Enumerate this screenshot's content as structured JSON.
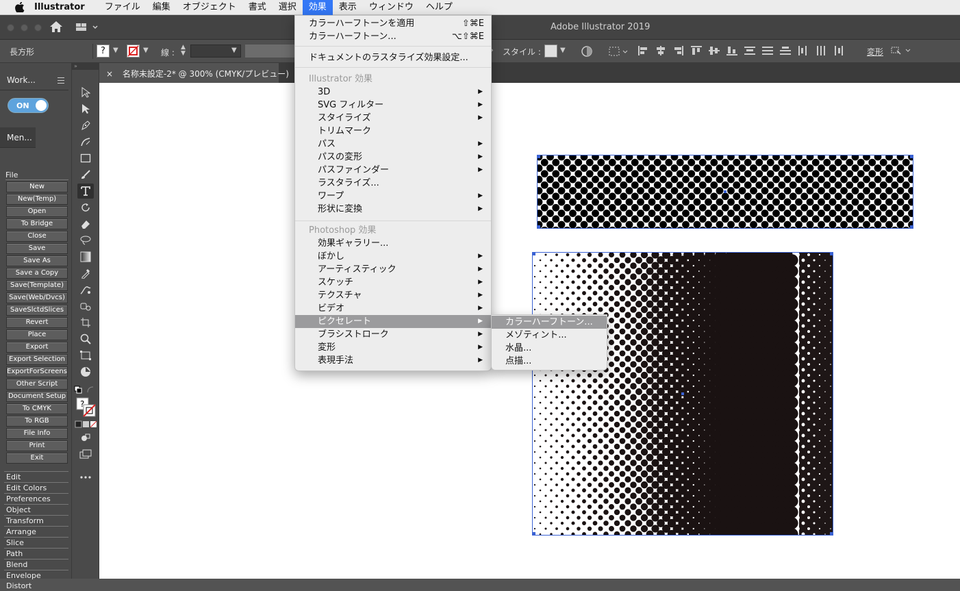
{
  "menubar": {
    "app_name": "Illustrator",
    "items": [
      "ファイル",
      "編集",
      "オブジェクト",
      "書式",
      "選択",
      "効果",
      "表示",
      "ウィンドウ",
      "ヘルプ"
    ],
    "active_index": 5
  },
  "window": {
    "title": "Adobe Illustrator 2019"
  },
  "control_bar": {
    "shape_label": "長方形",
    "fill_value": "?",
    "stroke_label": "線 :",
    "style_label": "スタイル :",
    "transform_label": "変形"
  },
  "document": {
    "tab_title": "名称未設定-2* @ 300% (CMYK/プレビュー)",
    "close_glyph": "×"
  },
  "left_panel": {
    "collapse_left": "«",
    "collapse_right": "»",
    "tab1": "Work...",
    "tab2": "Men...",
    "toggle_label": "ON",
    "file_header": "File",
    "buttons": [
      "New",
      "New(Temp)",
      "Open",
      "To Bridge",
      "Close",
      "Save",
      "Save As",
      "Save a Copy",
      "Save(Template)",
      "Save(Web/Dvcs)",
      "SaveSlctdSlices",
      "Revert",
      "Place",
      "Export",
      "Export Selection",
      "ExportForScreens",
      "Other Script",
      "Document Setup",
      "To CMYK",
      "To RGB",
      "File Info",
      "Print",
      "Exit"
    ],
    "categories": [
      "Edit",
      "Edit Colors",
      "Preferences",
      "Object",
      "Transform",
      "Arrange",
      "Slice",
      "Path",
      "Blend",
      "Envelope Distort"
    ]
  },
  "effect_menu": {
    "apply_last": {
      "label": "カラーハーフトーンを適用",
      "shortcut": "⇧⌘E"
    },
    "last_effect": {
      "label": "カラーハーフトーン...",
      "shortcut": "⌥⇧⌘E"
    },
    "raster_settings": "ドキュメントのラスタライズ効果設定...",
    "illustrator_header": "Illustrator 効果",
    "illustrator_items": [
      {
        "label": "3D",
        "submenu": true
      },
      {
        "label": "SVG フィルター",
        "submenu": true
      },
      {
        "label": "スタイライズ",
        "submenu": true
      },
      {
        "label": "トリムマーク",
        "submenu": false
      },
      {
        "label": "パス",
        "submenu": true
      },
      {
        "label": "パスの変形",
        "submenu": true
      },
      {
        "label": "パスファインダー",
        "submenu": true
      },
      {
        "label": "ラスタライズ...",
        "submenu": false
      },
      {
        "label": "ワープ",
        "submenu": true
      },
      {
        "label": "形状に変換",
        "submenu": true
      }
    ],
    "photoshop_header": "Photoshop 効果",
    "photoshop_items": [
      {
        "label": "効果ギャラリー...",
        "submenu": false
      },
      {
        "label": "ぼかし",
        "submenu": true
      },
      {
        "label": "アーティスティック",
        "submenu": true
      },
      {
        "label": "スケッチ",
        "submenu": true
      },
      {
        "label": "テクスチャ",
        "submenu": true
      },
      {
        "label": "ビデオ",
        "submenu": true
      },
      {
        "label": "ピクセレート",
        "submenu": true,
        "highlighted": true
      },
      {
        "label": "ブラシストローク",
        "submenu": true
      },
      {
        "label": "変形",
        "submenu": true
      },
      {
        "label": "表現手法",
        "submenu": true
      }
    ]
  },
  "pixelate_submenu": [
    "カラーハーフトーン...",
    "メゾティント...",
    "水晶...",
    "点描..."
  ],
  "colors": {
    "accent": "#3478f6",
    "highlight": "#9b9b9d",
    "selection": "#3a62d4"
  }
}
